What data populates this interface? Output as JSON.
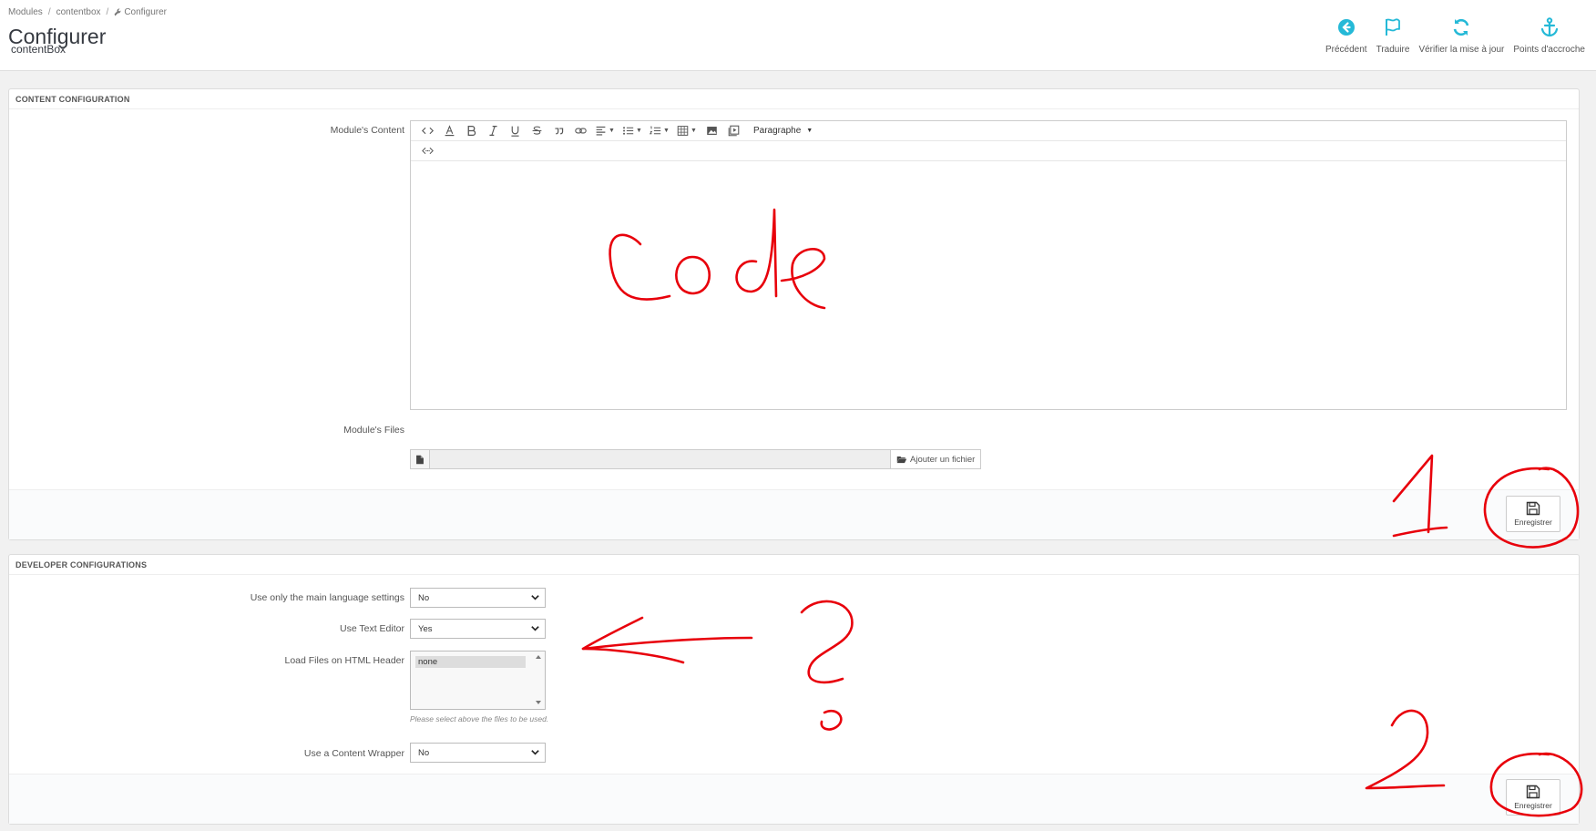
{
  "breadcrumb": [
    "Modules",
    "contentbox",
    "Configurer"
  ],
  "breadcrumb_sep": "/",
  "header": {
    "title": "Configurer",
    "subtitle": "contentBox"
  },
  "toolbar": [
    {
      "label": "Précédent",
      "icon": "back-circle-icon"
    },
    {
      "label": "Traduire",
      "icon": "flag-icon"
    },
    {
      "label": "Vérifier la mise à jour",
      "icon": "refresh-icon"
    },
    {
      "label": "Points d'accroche",
      "icon": "anchor-icon"
    }
  ],
  "content_panel": {
    "heading": "CONTENT CONFIGURATION",
    "content_label": "Module's Content",
    "paragraph_select": "Paragraphe",
    "files_label": "Module's Files",
    "add_file_label": "Ajouter un fichier",
    "save_label": "Enregistrer"
  },
  "developer_panel": {
    "heading": "DEVELOPER CONFIGURATIONS",
    "main_lang_label": "Use only the main language settings",
    "main_lang_value": "No",
    "text_editor_label": "Use Text Editor",
    "text_editor_value": "Yes",
    "load_files_label": "Load Files on HTML Header",
    "load_files_option": "none",
    "load_files_help": "Please select above the files to be used.",
    "wrapper_label": "Use a Content Wrapper",
    "wrapper_value": "No",
    "save_label": "Enregistrer"
  },
  "annotations": {
    "editor_scribble": "Code",
    "number_1": "1",
    "number_2": "2",
    "question": "?"
  },
  "colors": {
    "accent": "#25b9d7",
    "annotation": "#e8000b"
  }
}
